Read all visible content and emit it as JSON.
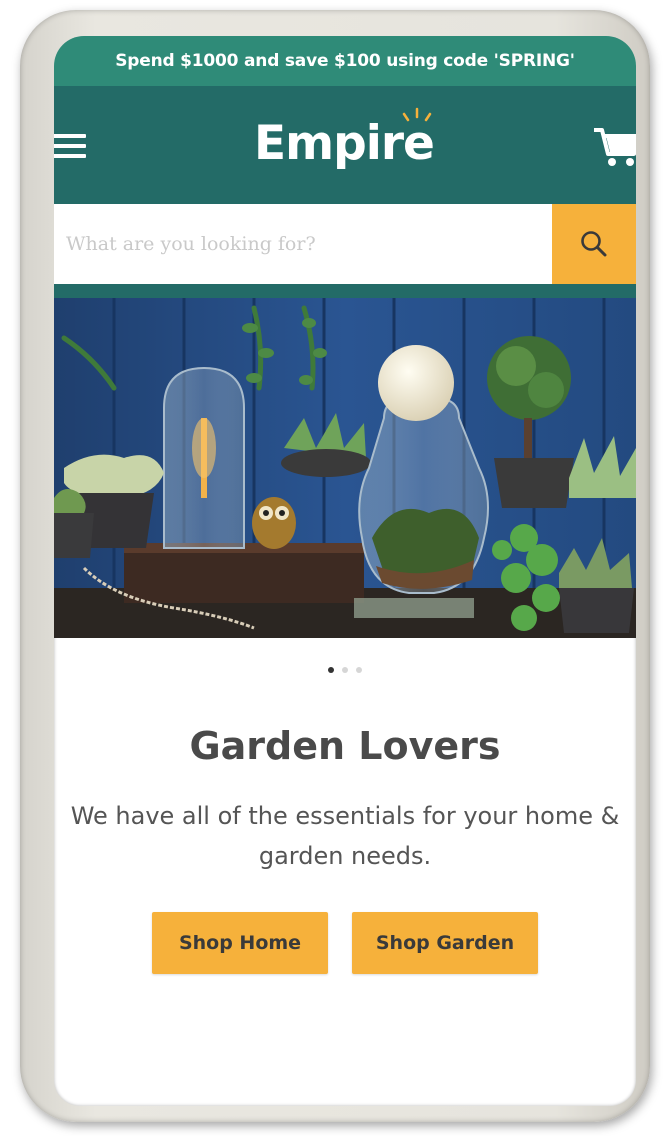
{
  "promo": {
    "text": "Spend $1000 and save $100 using code 'SPRING'"
  },
  "header": {
    "logo": "Empire",
    "menu_icon": "hamburger-menu-icon",
    "cart_icon": "shopping-cart-icon"
  },
  "search": {
    "placeholder": "What are you looking for?",
    "button_icon": "search-icon"
  },
  "carousel": {
    "slide_count": 3,
    "active_index": 0
  },
  "hero": {
    "title": "Garden Lovers",
    "description": "We have all of the essentials for your home & garden needs."
  },
  "buttons": {
    "shop_home": "Shop Home",
    "shop_garden": "Shop Garden"
  },
  "colors": {
    "promo_bg": "#2f8b78",
    "header_bg": "#236b67",
    "accent": "#f6b13b",
    "text": "#4a4a4a"
  }
}
